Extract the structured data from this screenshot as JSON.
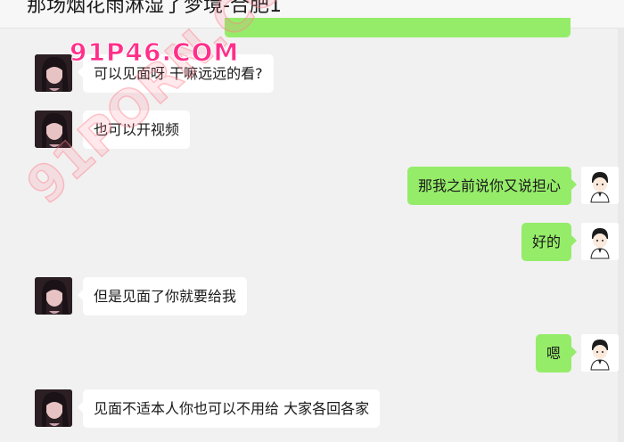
{
  "header": {
    "title": "那场烟花雨淋湿了梦境-合肥1"
  },
  "watermarks": {
    "logo": "91P46.COM",
    "diagonal": "91PORN.COM"
  },
  "messages": [
    {
      "side": "in",
      "text": "可以见面呀  干嘛远远的看?"
    },
    {
      "side": "in",
      "text": "也可以开视频"
    },
    {
      "side": "out",
      "text": "那我之前说你又说担心"
    },
    {
      "side": "out",
      "text": "好的"
    },
    {
      "side": "in",
      "text": "但是见面了你就要给我"
    },
    {
      "side": "out",
      "text": "嗯"
    },
    {
      "side": "in",
      "text": "见面不适本人你也可以不用给  大家各回各家"
    }
  ],
  "colors": {
    "outgoing_bubble": "#95ec69",
    "incoming_bubble": "#ffffff",
    "background": "#f1f1f1"
  }
}
